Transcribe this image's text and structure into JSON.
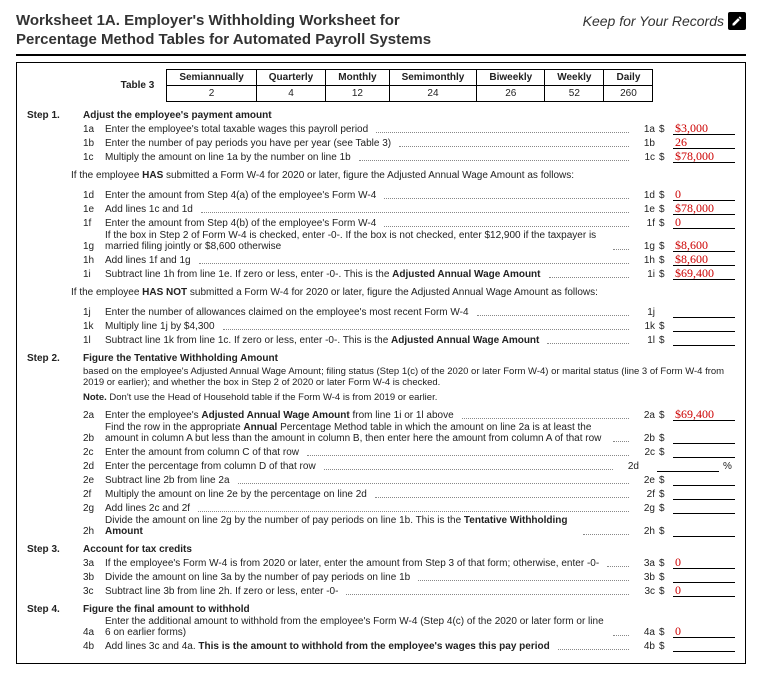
{
  "header": {
    "title_line1": "Worksheet 1A. Employer's Withholding Worksheet for",
    "title_line2": "Percentage Method Tables for Automated Payroll Systems",
    "keep": "Keep for Your Records"
  },
  "table3": {
    "label": "Table 3",
    "headers": [
      "Semiannually",
      "Quarterly",
      "Monthly",
      "Semimonthly",
      "Biweekly",
      "Weekly",
      "Daily"
    ],
    "values": [
      "2",
      "4",
      "12",
      "24",
      "26",
      "52",
      "260"
    ]
  },
  "step1": {
    "label": "Step 1.",
    "heading": "Adjust the employee's payment amount",
    "l1a": {
      "tag": "1a",
      "text": "Enter the employee's total taxable wages this payroll period",
      "num": "1a",
      "value": "$3,000"
    },
    "l1b": {
      "tag": "1b",
      "text": "Enter the number of pay periods you have per year (see Table 3)",
      "num": "1b",
      "value": "26"
    },
    "l1c": {
      "tag": "1c",
      "text": "Multiply the amount on line 1a by the number on line 1b",
      "num": "1c",
      "value": "$78,000"
    },
    "has_intro": "If the employee HAS submitted a Form W-4 for 2020 or later, figure the Adjusted Annual Wage Amount as follows:",
    "l1d": {
      "tag": "1d",
      "text": "Enter the amount from Step 4(a) of the employee's Form W-4",
      "num": "1d",
      "value": "0"
    },
    "l1e": {
      "tag": "1e",
      "text": "Add lines 1c and 1d",
      "num": "1e",
      "value": "$78,000"
    },
    "l1f": {
      "tag": "1f",
      "text": "Enter the amount from Step 4(b) of the employee's Form W-4",
      "num": "1f",
      "value": "0"
    },
    "l1g": {
      "tag": "1g",
      "text": "If the box in Step 2 of Form W-4 is checked, enter -0-. If the box is not checked, enter $12,900 if the taxpayer is married filing jointly or $8,600 otherwise",
      "num": "1g",
      "value": "$8,600"
    },
    "l1h": {
      "tag": "1h",
      "text": "Add lines 1f and 1g",
      "num": "1h",
      "value": "$8,600"
    },
    "l1i": {
      "tag": "1i",
      "text_pre": "Subtract line 1h from line 1e. If zero or less, enter -0-. This is the ",
      "text_bold": "Adjusted Annual Wage Amount",
      "num": "1i",
      "value": "$69,400"
    },
    "hasnot_intro": "If the employee HAS NOT submitted a Form W-4 for 2020 or later, figure the Adjusted Annual Wage Amount as follows:",
    "l1j": {
      "tag": "1j",
      "text": "Enter the number of allowances claimed on the employee's most recent Form W-4",
      "num": "1j",
      "value": ""
    },
    "l1k": {
      "tag": "1k",
      "text": "Multiply line 1j by $4,300",
      "num": "1k",
      "value": ""
    },
    "l1l": {
      "tag": "1l",
      "text_pre": "Subtract line 1k from line 1c. If zero or less, enter -0-. This is the ",
      "text_bold": "Adjusted Annual Wage Amount",
      "num": "1l",
      "value": ""
    }
  },
  "step2": {
    "label": "Step 2.",
    "heading": "Figure the Tentative Withholding Amount",
    "note1": "based on the employee's Adjusted Annual Wage Amount; filing status (Step 1(c) of the 2020 or later Form W-4) or marital status (line 3 of Form W-4 from 2019 or earlier); and whether the box in Step 2 of 2020 or later Form W-4 is checked.",
    "note2_pre": "Note.",
    "note2": " Don't use the Head of Household table if the Form W-4 is from 2019 or earlier.",
    "l2a": {
      "tag": "2a",
      "text_pre": "Enter the employee's ",
      "text_bold": "Adjusted Annual Wage Amount",
      "text_post": " from line 1i or 1l above",
      "num": "2a",
      "value": "$69,400"
    },
    "l2b": {
      "tag": "2b",
      "text": "Find the row in the appropriate Annual Percentage Method table in which the amount on line 2a is at least the amount in column A but less than the amount in column B, then enter here the amount from column A of that row",
      "num": "2b",
      "value": ""
    },
    "l2c": {
      "tag": "2c",
      "text": "Enter the amount from column C of that row",
      "num": "2c",
      "value": ""
    },
    "l2d": {
      "tag": "2d",
      "text": "Enter the percentage from column D of that row",
      "num": "2d",
      "value": ""
    },
    "l2e": {
      "tag": "2e",
      "text": "Subtract line 2b from line 2a",
      "num": "2e",
      "value": ""
    },
    "l2f": {
      "tag": "2f",
      "text": "Multiply the amount on line 2e by the percentage on line 2d",
      "num": "2f",
      "value": ""
    },
    "l2g": {
      "tag": "2g",
      "text": "Add lines 2c and 2f",
      "num": "2g",
      "value": ""
    },
    "l2h": {
      "tag": "2h",
      "text_pre": "Divide the amount on line 2g by the number of pay periods on line 1b. This is the ",
      "text_bold": "Tentative Withholding Amount",
      "num": "2h",
      "value": ""
    }
  },
  "step3": {
    "label": "Step 3.",
    "heading": "Account for tax credits",
    "l3a": {
      "tag": "3a",
      "text": "If the employee's Form W-4 is from 2020 or later, enter the amount from Step 3 of that form; otherwise, enter -0-",
      "num": "3a",
      "value": "0"
    },
    "l3b": {
      "tag": "3b",
      "text": "Divide the amount on line 3a by the number of pay periods on line 1b",
      "num": "3b",
      "value": ""
    },
    "l3c": {
      "tag": "3c",
      "text": "Subtract line 3b from line 2h. If zero or less, enter -0-",
      "num": "3c",
      "value": "0"
    }
  },
  "step4": {
    "label": "Step 4.",
    "heading": "Figure the final amount to withhold",
    "l4a": {
      "tag": "4a",
      "text": "Enter the additional amount to withhold from the employee's Form W-4 (Step 4(c) of the 2020 or later form or line 6 on earlier forms)",
      "num": "4a",
      "value": "0"
    },
    "l4b": {
      "tag": "4b",
      "text_pre": "Add lines 3c and 4a. ",
      "text_bold": "This is the amount to withhold from the employee's wages this pay period",
      "num": "4b",
      "value": ""
    }
  },
  "labels": {
    "dollar": "$",
    "percent": "%"
  }
}
